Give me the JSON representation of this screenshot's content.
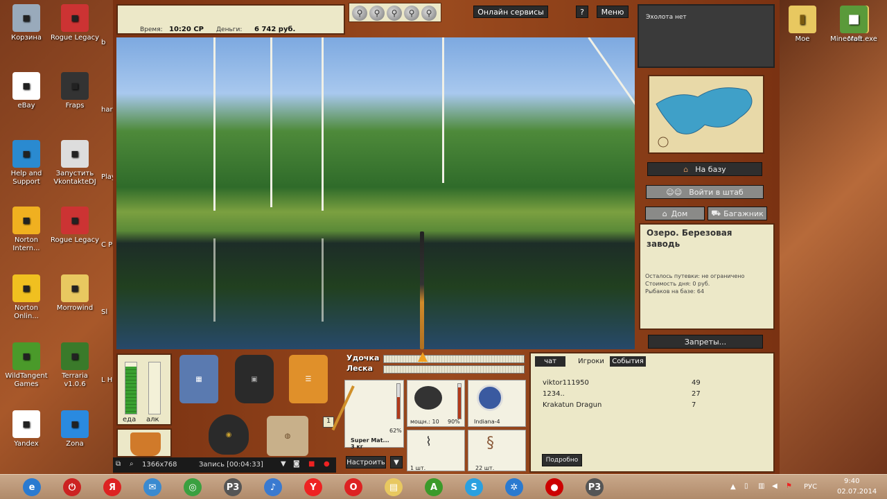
{
  "desktop": {
    "left_icons": [
      {
        "id": "trash",
        "label": "Корзина",
        "icon": "trash-icon",
        "color": "#9ab"
      },
      {
        "id": "rogue1",
        "label": "Rogue Legacy",
        "icon": "rogue-legacy-icon",
        "color": "#c33"
      },
      {
        "id": "ebay",
        "label": "eBay",
        "icon": "ebay-icon",
        "color": "#fff"
      },
      {
        "id": "fraps",
        "label": "Fraps",
        "icon": "fraps-icon",
        "color": "#333"
      },
      {
        "id": "help",
        "label": "Help and Support",
        "icon": "help-icon",
        "color": "#2a8ad0"
      },
      {
        "id": "vkdj",
        "label": "Запустить VkontakteDJ",
        "icon": "vkontaktedj-icon",
        "color": "#ddd"
      },
      {
        "id": "norton",
        "label": "Norton Intern...",
        "icon": "norton-internet-icon",
        "color": "#f0b020"
      },
      {
        "id": "rogue2",
        "label": "Rogue Legacy",
        "icon": "rogue-legacy-icon",
        "color": "#c33"
      },
      {
        "id": "nortonol",
        "label": "Norton Onlin...",
        "icon": "norton-online-icon",
        "color": "#f0c020"
      },
      {
        "id": "morrowind",
        "label": "Morrowind",
        "icon": "folder-icon",
        "color": "#e8c860"
      },
      {
        "id": "wildtangent",
        "label": "WildTangent Games",
        "icon": "wildtangent-icon",
        "color": "#4a9a2a"
      },
      {
        "id": "terraria",
        "label": "Terraria v1.0.6",
        "icon": "terraria-icon",
        "color": "#3a7a2a"
      },
      {
        "id": "yandex",
        "label": "Yandex",
        "icon": "yandex-icon",
        "color": "#fff"
      },
      {
        "id": "zona",
        "label": "Zona",
        "icon": "zona-icon",
        "color": "#2a8ae0"
      }
    ],
    "partial_labels": [
      "b",
      "har",
      "Play",
      "C Play",
      "Sl",
      "L H"
    ],
    "right_icons": [
      {
        "id": "moe",
        "label": "Мое",
        "icon": "folder-icon",
        "color": "#e8c860"
      },
      {
        "id": "minecraft",
        "label": "Minecraft.exe",
        "icon": "minecraft-icon",
        "color": "#5a9a3a"
      }
    ]
  },
  "game": {
    "time_label": "Время:",
    "time_value": "10:20 СР",
    "money_label": "Деньги:",
    "money_value": "6 742 руб.",
    "online_services": "Онлайн сервисы",
    "help": "?",
    "menu": "Меню",
    "sonar_text": "Эхолота нет",
    "to_base": "На базу",
    "enter_hq": "Войти в штаб",
    "home": "Дом",
    "trunk": "Багажник",
    "location_title": "Озеро. Березовая заводь",
    "permit": "Осталось путевки: не ограничено",
    "day_cost": "Стоимость дня: 0 руб.",
    "anglers": "Рыбаков на базе: 64",
    "bans": "Запреты...",
    "food_label": "еда",
    "alc_label": "алк",
    "slot_count": "1",
    "rod_label": "Удочка",
    "line_label": "Леска",
    "rod_name": "Super Mat...",
    "rod_weight": "3 кг",
    "rod_pct": "62%",
    "reel_power": "мощн.: 10",
    "reel_pct": "90%",
    "line_name": "Indiana-4",
    "hook_count": "1 шт.",
    "bait_count": "22 шт.",
    "setup": "Настроить",
    "setup_arrow": "▼",
    "tabs": [
      "чат",
      "Игроки",
      "События"
    ],
    "players": [
      {
        "name": "viktor111950",
        "score": "49"
      },
      {
        "name": "1234..",
        "score": "27"
      },
      {
        "name": "Krakatun Dragun",
        "score": "7"
      }
    ],
    "details": "Подробно",
    "rod_level": 0.62,
    "reel_level": 0.9,
    "food_level": 0.92,
    "alc_level": 0.0
  },
  "recorder": {
    "resolution": "1366x768",
    "recording": "Запись [00:04:33]"
  },
  "taskbar": {
    "apps": [
      "ie-icon",
      "power-icon",
      "yandex-browser-icon",
      "mail-icon",
      "chrome-icon",
      "rf3-icon",
      "speaker-icon",
      "yandex-icon",
      "opera-icon",
      "explorer-icon",
      "a-icon",
      "skype-icon",
      "bluetooth-icon",
      "record-icon",
      "rf3-icon"
    ],
    "lang": "РУС",
    "time": "9:40",
    "date": "02.07.2014"
  }
}
